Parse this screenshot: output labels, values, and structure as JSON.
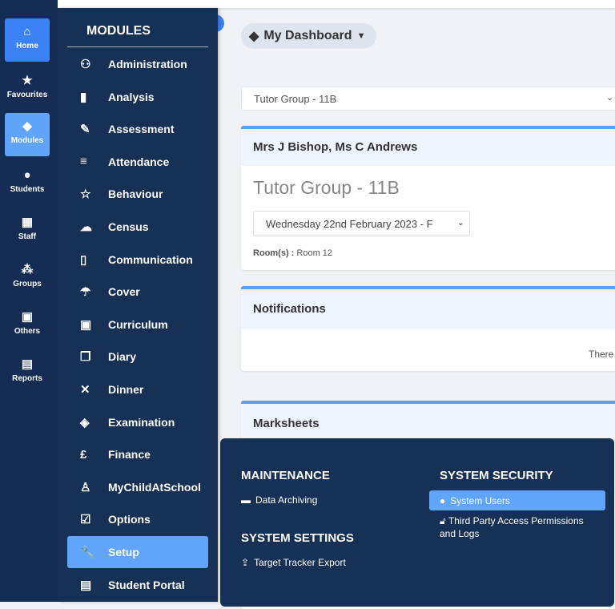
{
  "rail": [
    {
      "label": "Home",
      "icon": "home-icon",
      "glyph": "⌂"
    },
    {
      "label": "Favourites",
      "icon": "star-icon",
      "glyph": "★"
    },
    {
      "label": "Modules",
      "icon": "shapes-icon",
      "glyph": "◆"
    },
    {
      "label": "Students",
      "icon": "user-icon",
      "glyph": "●"
    },
    {
      "label": "Staff",
      "icon": "staff-icon",
      "glyph": "▦"
    },
    {
      "label": "Groups",
      "icon": "users-icon",
      "glyph": "⁂"
    },
    {
      "label": "Others",
      "icon": "presentation-icon",
      "glyph": "▣"
    },
    {
      "label": "Reports",
      "icon": "file-icon",
      "glyph": "▤"
    }
  ],
  "modules": {
    "title": "MODULES",
    "items": [
      {
        "label": "Administration",
        "glyph": "⚇"
      },
      {
        "label": "Analysis",
        "glyph": "▮"
      },
      {
        "label": "Assessment",
        "glyph": "✎"
      },
      {
        "label": "Attendance",
        "glyph": "≡"
      },
      {
        "label": "Behaviour",
        "glyph": "☆"
      },
      {
        "label": "Census",
        "glyph": "☁"
      },
      {
        "label": "Communication",
        "glyph": "▯"
      },
      {
        "label": "Cover",
        "glyph": "☂"
      },
      {
        "label": "Curriculum",
        "glyph": "▣"
      },
      {
        "label": "Diary",
        "glyph": "❒"
      },
      {
        "label": "Dinner",
        "glyph": "✕"
      },
      {
        "label": "Examination",
        "glyph": "◈"
      },
      {
        "label": "Finance",
        "glyph": "£"
      },
      {
        "label": "MyChildAtSchool",
        "glyph": "♙"
      },
      {
        "label": "Options",
        "glyph": "☑"
      },
      {
        "label": "Setup",
        "glyph": "🔧"
      },
      {
        "label": "Student Portal",
        "glyph": "▤"
      }
    ],
    "active": "Setup"
  },
  "dashboard": {
    "label": "My Dashboard"
  },
  "group_select": {
    "value": "Tutor Group - 11B"
  },
  "tutor_card": {
    "header": "Mrs J Bishop, Ms C Andrews",
    "title": "Tutor Group - 11B",
    "date": "Wednesday 22nd February 2023 - F",
    "room_label": "Room(s) :",
    "room": "Room 12"
  },
  "notifications": {
    "header": "Notifications",
    "body": "There"
  },
  "marksheets": {
    "header": "Marksheets"
  },
  "flyout": {
    "maintenance": {
      "title": "MAINTENANCE",
      "items": [
        "Data Archiving"
      ]
    },
    "system_settings": {
      "title": "SYSTEM SETTINGS",
      "items": [
        "Target Tracker Export"
      ]
    },
    "system_security": {
      "title": "SYSTEM SECURITY",
      "items": [
        "System Users",
        "Third Party Access Permissions and Logs"
      ],
      "active": "System Users"
    }
  },
  "colors": {
    "rail": "#152d54",
    "panel": "#163056",
    "active": "#60a5fa",
    "home": "#3b82f6"
  }
}
